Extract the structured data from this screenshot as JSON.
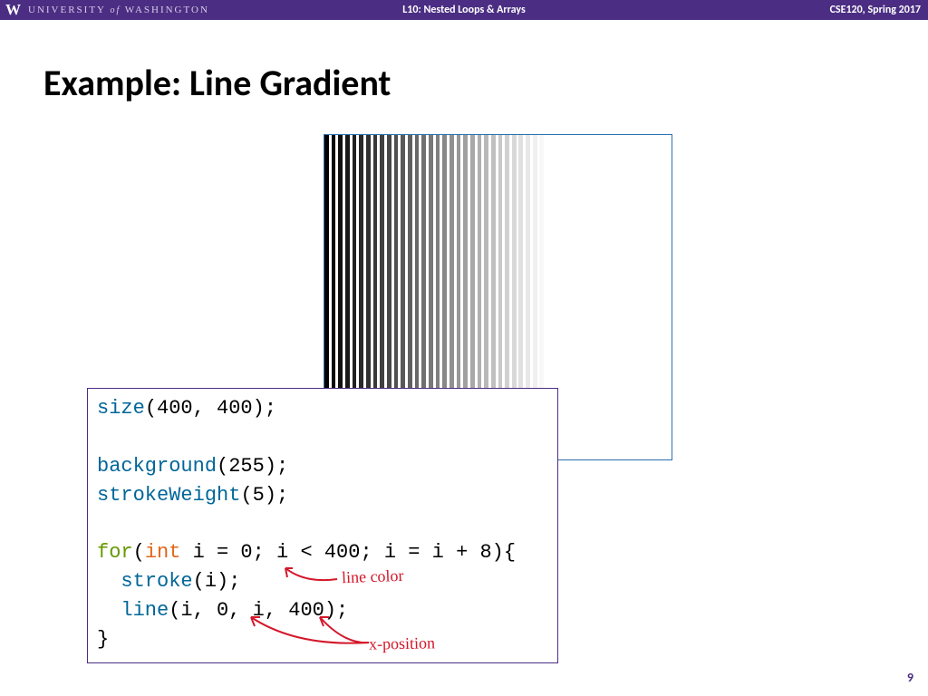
{
  "header": {
    "logo": "W",
    "university_pre": "UNIVERSITY",
    "university_of": " of ",
    "university_post": "WASHINGTON",
    "lecture": "L10:  Nested Loops & Arrays",
    "course": "CSE120, Spring 2017"
  },
  "title": "Example:  Line Gradient",
  "code": {
    "l1_size": "size",
    "l1_rest": "(400, 400);",
    "l3_bg": "background",
    "l3_rest": "(255);",
    "l4_sw": "strokeWeight",
    "l4_rest": "(5);",
    "l6_for": "for",
    "l6_p1": "(",
    "l6_int": "int",
    "l6_rest": " i = 0; i < 400; i = i + 8){",
    "l7_indent": "  ",
    "l7_stroke": "stroke",
    "l7_rest": "(i);",
    "l8_indent": "  ",
    "l8_line": "line",
    "l8_rest": "(i, 0, i, 400);",
    "l9": "}"
  },
  "annotations": {
    "line_color": "line color",
    "x_position": "x-position"
  },
  "gradient": {
    "i_start": 0,
    "i_end": 400,
    "i_step": 8,
    "canvas_size": 400,
    "stroke_weight": 5,
    "background": 255
  },
  "page": "9"
}
